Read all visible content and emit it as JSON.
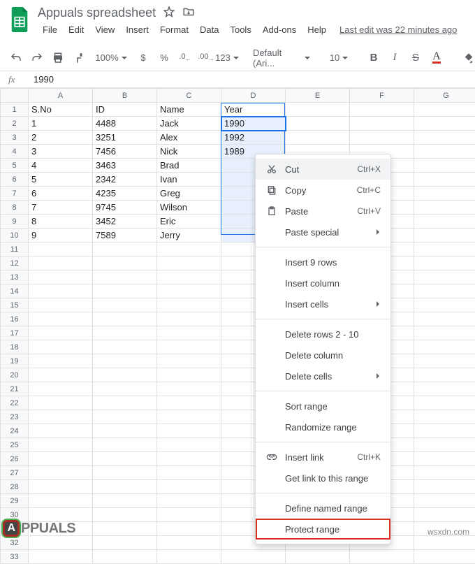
{
  "doc": {
    "title": "Appuals spreadsheet"
  },
  "menus": [
    "File",
    "Edit",
    "View",
    "Insert",
    "Format",
    "Data",
    "Tools",
    "Add-ons",
    "Help"
  ],
  "last_edit": "Last edit was 22 minutes ago",
  "toolbar": {
    "zoom": "100%",
    "currency": "$",
    "percent": "%",
    "dec_dec": ".0",
    "inc_dec": ".00",
    "more_formats": "123",
    "font": "Default (Ari...",
    "font_size": "10",
    "bold": "B",
    "italic": "I",
    "strike": "S",
    "textcolor": "A"
  },
  "formula": {
    "label": "fx",
    "value": "1990"
  },
  "columns": [
    "A",
    "B",
    "C",
    "D",
    "E",
    "F",
    "G"
  ],
  "headers": {
    "sno": "S.No",
    "id": "ID",
    "name": "Name",
    "year": "Year"
  },
  "rows": [
    {
      "sno": 1,
      "id": 4488,
      "name": "Jack",
      "year": 1990
    },
    {
      "sno": 2,
      "id": 3251,
      "name": "Alex",
      "year": 1992
    },
    {
      "sno": 3,
      "id": 7456,
      "name": "Nick",
      "year": 1989
    },
    {
      "sno": 4,
      "id": 3463,
      "name": "Brad",
      "year": ""
    },
    {
      "sno": 5,
      "id": 2342,
      "name": "Ivan",
      "year": ""
    },
    {
      "sno": 6,
      "id": 4235,
      "name": "Greg",
      "year": ""
    },
    {
      "sno": 7,
      "id": 9745,
      "name": "Wilson",
      "year": ""
    },
    {
      "sno": 8,
      "id": 3452,
      "name": "Eric",
      "year": ""
    },
    {
      "sno": 9,
      "id": 7589,
      "name": "Jerry",
      "year": ""
    }
  ],
  "row_numbers_extra_start": 11,
  "row_numbers_extra_end": 33,
  "ctx": {
    "cut": {
      "label": "Cut",
      "shortcut": "Ctrl+X"
    },
    "copy": {
      "label": "Copy",
      "shortcut": "Ctrl+C"
    },
    "paste": {
      "label": "Paste",
      "shortcut": "Ctrl+V"
    },
    "paste_special": {
      "label": "Paste special"
    },
    "insert_rows": {
      "label": "Insert 9 rows"
    },
    "insert_column": {
      "label": "Insert column"
    },
    "insert_cells": {
      "label": "Insert cells"
    },
    "delete_rows": {
      "label": "Delete rows 2 - 10"
    },
    "delete_column": {
      "label": "Delete column"
    },
    "delete_cells": {
      "label": "Delete cells"
    },
    "sort_range": {
      "label": "Sort range"
    },
    "randomize_range": {
      "label": "Randomize range"
    },
    "insert_link": {
      "label": "Insert link",
      "shortcut": "Ctrl+K"
    },
    "get_link": {
      "label": "Get link to this range"
    },
    "define_named_range": {
      "label": "Define named range"
    },
    "protect_range": {
      "label": "Protect range"
    }
  },
  "watermarks": {
    "appuals_pre": "A",
    "appuals_rest": "PPUALS",
    "domain": "wsxdn.com"
  }
}
